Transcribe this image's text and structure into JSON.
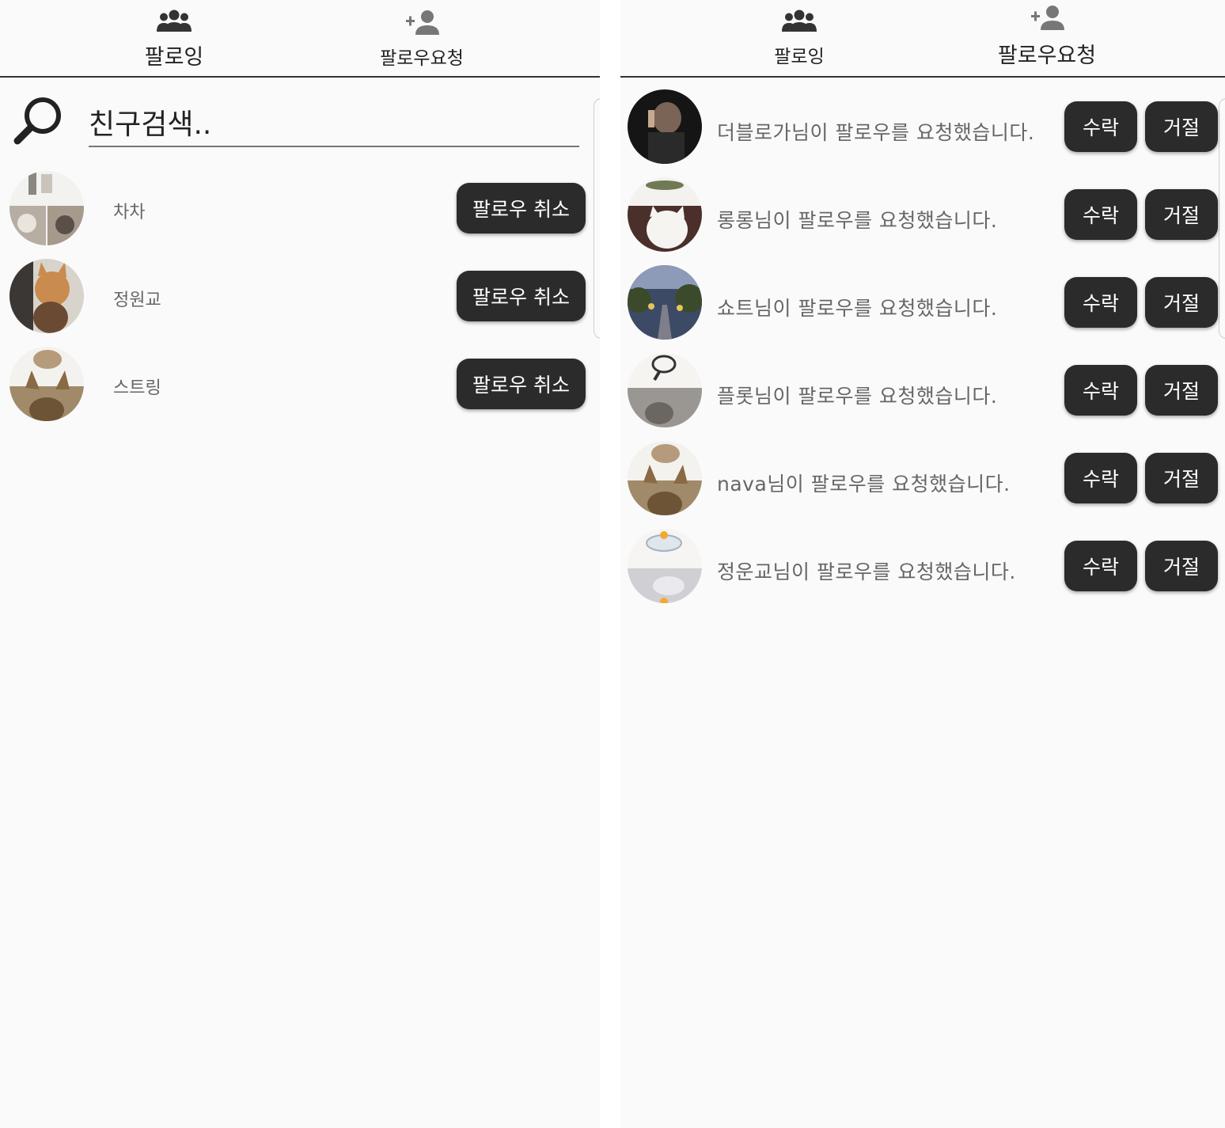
{
  "left": {
    "tabs": {
      "following": "팔로잉",
      "requests": "팔로우요청"
    },
    "search": {
      "placeholder": "친구검색.."
    },
    "friends": [
      {
        "name": "차차",
        "button": "팔로우 취소"
      },
      {
        "name": "정원교",
        "button": "팔로우 취소"
      },
      {
        "name": "스트링",
        "button": "팔로우 취소"
      }
    ]
  },
  "right": {
    "tabs": {
      "following": "팔로잉",
      "requests": "팔로우요청"
    },
    "requests": [
      {
        "text": "더블로가님이 팔로우를 요청했습니다.",
        "accept": "수락",
        "reject": "거절"
      },
      {
        "text": "롱롱님이 팔로우를 요청했습니다.",
        "accept": "수락",
        "reject": "거절"
      },
      {
        "text": "쇼트님이 팔로우를 요청했습니다.",
        "accept": "수락",
        "reject": "거절"
      },
      {
        "text": "플롯님이 팔로우를 요청했습니다.",
        "accept": "수락",
        "reject": "거절"
      },
      {
        "text": "nava님이 팔로우를 요청했습니다.",
        "accept": "수락",
        "reject": "거절"
      },
      {
        "text": "정운교님이 팔로우를 요청했습니다.",
        "accept": "수락",
        "reject": "거절"
      }
    ]
  },
  "colors": {
    "background": "#fafafa",
    "button": "#2b2b2b",
    "button_text": "#ffffff",
    "secondary_text": "#666666",
    "divider": "#333333"
  },
  "icons": {
    "following_tab": "group-icon",
    "requests_tab": "person-add-icon",
    "search": "search-icon"
  }
}
